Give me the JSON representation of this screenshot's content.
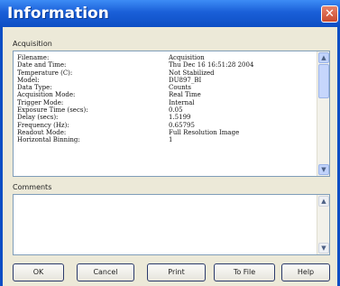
{
  "window": {
    "title": "Information",
    "close_glyph": "✕"
  },
  "acquisition": {
    "label": "Acquisition",
    "rows": [
      {
        "key": "Filename:",
        "value": "Acquisition"
      },
      {
        "key": "Date and Time:",
        "value": "Thu Dec 16 16:51:28 2004"
      },
      {
        "key": "Temperature (C):",
        "value": "Not Stabilized"
      },
      {
        "key": "Model:",
        "value": "DU897_BI"
      },
      {
        "key": "Data Type:",
        "value": "Counts"
      },
      {
        "key": "Acquisition Mode:",
        "value": "Real Time"
      },
      {
        "key": "Trigger Mode:",
        "value": "Internal"
      },
      {
        "key": "Exposure Time (secs):",
        "value": "0.05"
      },
      {
        "key": "Delay (secs):",
        "value": "1.5199"
      },
      {
        "key": "Frequency (Hz):",
        "value": "0.65795"
      },
      {
        "key": "Readout Mode:",
        "value": "Full Resolution Image"
      },
      {
        "key": "Horizontal Binning:",
        "value": "1"
      }
    ]
  },
  "comments": {
    "label": "Comments",
    "value": ""
  },
  "buttons": {
    "ok": "OK",
    "cancel": "Cancel",
    "print": "Print",
    "tofile": "To File",
    "help": "Help"
  },
  "icons": {
    "scroll_up": "up-arrow-icon",
    "scroll_down": "down-arrow-icon"
  }
}
